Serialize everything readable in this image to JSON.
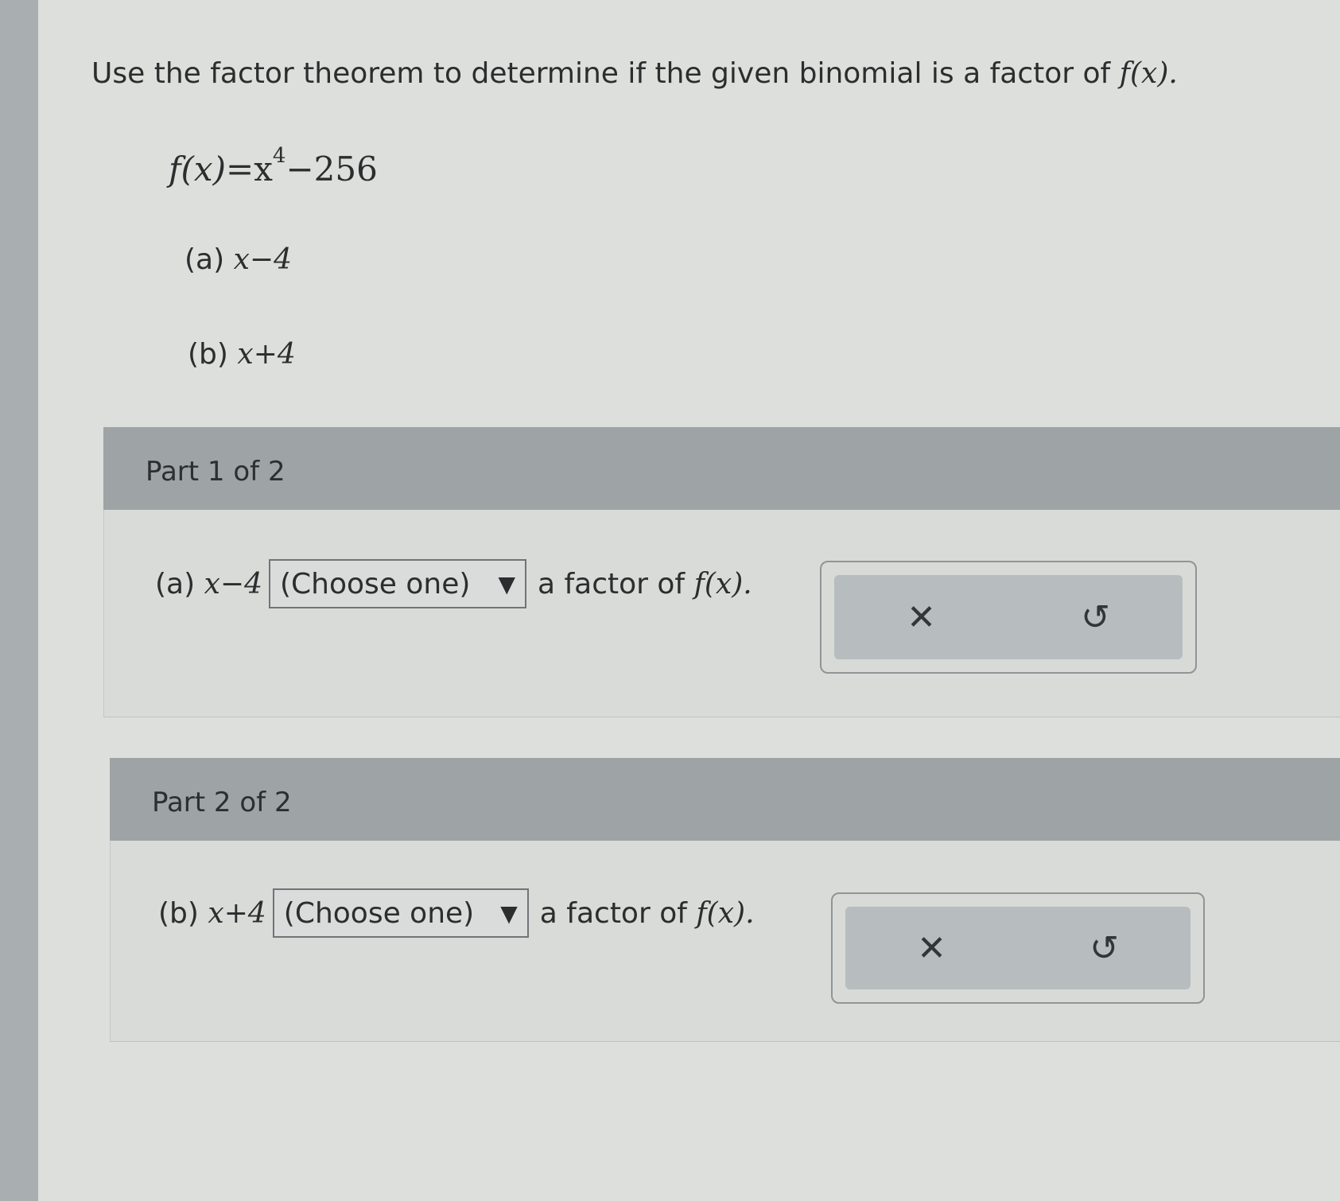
{
  "question": {
    "instruction": "Use the factor theorem to determine if the given binomial is a factor of",
    "fx": "f(x).",
    "function_lhs": "f(x)",
    "function_eq": "=x",
    "function_exp": "4",
    "function_rest": "−256",
    "item_a_label": "(a)",
    "item_a_expr": "x−4",
    "item_b_label": "(b)",
    "item_b_expr": "x+4"
  },
  "parts": [
    {
      "header": "Part 1 of 2",
      "prefix": "(a)",
      "expr": "x−4",
      "select_value": "(Choose one)",
      "suffix": "a factor of",
      "suffix_fx": "f(x).",
      "clear_icon": "✕",
      "reset_icon": "↺"
    },
    {
      "header": "Part 2 of 2",
      "prefix": "(b)",
      "expr": "x+4",
      "select_value": "(Choose one)",
      "suffix": "a factor of",
      "suffix_fx": "f(x).",
      "clear_icon": "✕",
      "reset_icon": "↺"
    }
  ]
}
